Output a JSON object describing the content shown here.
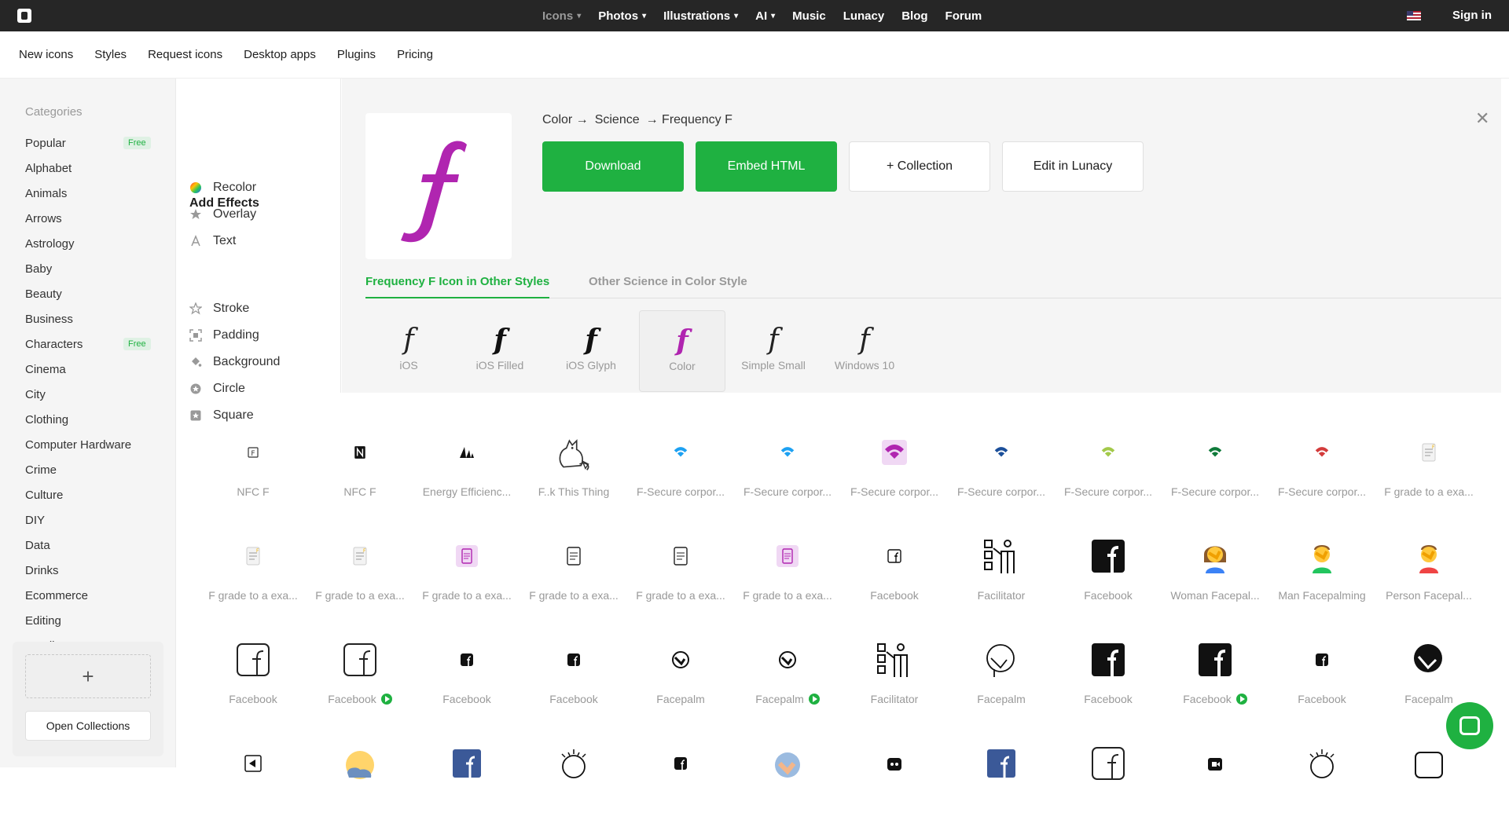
{
  "topnav": {
    "items": [
      {
        "label": "Icons",
        "dropdown": true
      },
      {
        "label": "Photos",
        "dropdown": true
      },
      {
        "label": "Illustrations",
        "dropdown": true
      },
      {
        "label": "AI",
        "dropdown": true
      },
      {
        "label": "Music",
        "dropdown": false
      },
      {
        "label": "Lunacy",
        "dropdown": false
      },
      {
        "label": "Blog",
        "dropdown": false
      },
      {
        "label": "Forum",
        "dropdown": false
      }
    ],
    "signin": "Sign in"
  },
  "subnav": [
    "New icons",
    "Styles",
    "Request icons",
    "Desktop apps",
    "Plugins",
    "Pricing"
  ],
  "sidebar": {
    "title": "Categories",
    "items": [
      {
        "label": "Popular",
        "badge": "Free"
      },
      {
        "label": "Alphabet"
      },
      {
        "label": "Animals"
      },
      {
        "label": "Arrows"
      },
      {
        "label": "Astrology"
      },
      {
        "label": "Baby"
      },
      {
        "label": "Beauty"
      },
      {
        "label": "Business"
      },
      {
        "label": "Characters",
        "badge": "Free"
      },
      {
        "label": "Cinema"
      },
      {
        "label": "City"
      },
      {
        "label": "Clothing"
      },
      {
        "label": "Computer Hardware"
      },
      {
        "label": "Crime"
      },
      {
        "label": "Culture"
      },
      {
        "label": "DIY"
      },
      {
        "label": "Data"
      },
      {
        "label": "Drinks"
      },
      {
        "label": "Ecommerce"
      },
      {
        "label": "Editing"
      },
      {
        "label": "Email"
      }
    ],
    "collections": {
      "add": "+",
      "open": "Open Collections"
    }
  },
  "effects": {
    "top": [
      {
        "label": "Recolor",
        "icon": "recolor-icon"
      },
      {
        "label": "Overlay",
        "icon": "overlay-icon"
      },
      {
        "label": "Text",
        "icon": "text-icon"
      }
    ],
    "add_title": "Add Effects",
    "add": [
      {
        "label": "Stroke",
        "icon": "star-icon"
      },
      {
        "label": "Padding",
        "icon": "padding-icon"
      },
      {
        "label": "Background",
        "icon": "fill-icon"
      },
      {
        "label": "Circle",
        "icon": "circle-icon"
      },
      {
        "label": "Square",
        "icon": "square-icon"
      }
    ]
  },
  "detail": {
    "preview_glyph": "f",
    "preview_color": "#b025b0",
    "breadcrumb": [
      "Color →",
      "Science",
      "→ Frequency F"
    ],
    "buttons": {
      "download": "Download",
      "embed": "Embed HTML",
      "collection": "+ Collection",
      "lunacy": "Edit in Lunacy"
    },
    "tabs": [
      "Frequency F Icon in Other Styles",
      "Other Science in Color Style"
    ],
    "styles": [
      {
        "label": "iOS",
        "glyph": "f"
      },
      {
        "label": "iOS Filled",
        "glyph": "f"
      },
      {
        "label": "iOS Glyph",
        "glyph": "f"
      },
      {
        "label": "Color",
        "glyph": "f"
      },
      {
        "label": "Simple Small",
        "glyph": "f"
      },
      {
        "label": "Windows 10",
        "glyph": "f"
      }
    ]
  },
  "grid": {
    "rows": [
      [
        {
          "name": "NFC F",
          "icon": "nfc-icon"
        },
        {
          "name": "NFC F",
          "icon": "nfc-filled-icon"
        },
        {
          "name": "Energy Efficienc...",
          "icon": "energy-icon"
        },
        {
          "name": "F..k This Thing",
          "icon": "cat-icon"
        },
        {
          "name": "F-Secure corpor...",
          "icon": "wifi-blue-icon"
        },
        {
          "name": "F-Secure corpor...",
          "icon": "wifi-blue-icon"
        },
        {
          "name": "F-Secure corpor...",
          "icon": "wifi-purple-icon"
        },
        {
          "name": "F-Secure corpor...",
          "icon": "wifi-dark-icon"
        },
        {
          "name": "F-Secure corpor...",
          "icon": "wifi-green-icon"
        },
        {
          "name": "F-Secure corpor...",
          "icon": "wifi-black-icon"
        },
        {
          "name": "F-Secure corpor...",
          "icon": "wifi-red-icon"
        },
        {
          "name": "F grade to a exa...",
          "icon": "document-icon"
        }
      ],
      [
        {
          "name": "F grade to a exa...",
          "icon": "document-icon"
        },
        {
          "name": "F grade to a exa...",
          "icon": "document-icon"
        },
        {
          "name": "F grade to a exa...",
          "icon": "document-purple-icon"
        },
        {
          "name": "F grade to a exa...",
          "icon": "document-outline-icon"
        },
        {
          "name": "F grade to a exa...",
          "icon": "document-outline-icon"
        },
        {
          "name": "F grade to a exa...",
          "icon": "document-purple-icon"
        },
        {
          "name": "Facebook",
          "icon": "facebook-icon"
        },
        {
          "name": "Facilitator",
          "icon": "facilitator-icon"
        },
        {
          "name": "Facebook",
          "icon": "facebook-filled-icon"
        },
        {
          "name": "Woman Facepal...",
          "icon": "woman-facepalm-icon"
        },
        {
          "name": "Man Facepalming",
          "icon": "man-facepalm-icon"
        },
        {
          "name": "Person Facepal...",
          "icon": "person-facepalm-icon"
        }
      ],
      [
        {
          "name": "Facebook",
          "icon": "facebook-outline-icon",
          "play": false
        },
        {
          "name": "Facebook",
          "icon": "facebook-outline-icon",
          "play": true
        },
        {
          "name": "Facebook",
          "icon": "facebook-small-icon",
          "play": false
        },
        {
          "name": "Facebook",
          "icon": "facebook-small-icon",
          "play": false
        },
        {
          "name": "Facepalm",
          "icon": "facepalm-icon",
          "play": false
        },
        {
          "name": "Facepalm",
          "icon": "facepalm-icon",
          "play": true
        },
        {
          "name": "Facilitator",
          "icon": "facilitator-icon",
          "play": false
        },
        {
          "name": "Facepalm",
          "icon": "facepalm-outline-icon",
          "play": false
        },
        {
          "name": "Facebook",
          "icon": "facebook-filled-icon",
          "play": false
        },
        {
          "name": "Facebook",
          "icon": "facebook-filled-icon",
          "play": true
        },
        {
          "name": "Facebook",
          "icon": "facebook-small-icon",
          "play": false
        },
        {
          "name": "Facepalm",
          "icon": "facepalm-filled-icon",
          "play": false
        }
      ],
      [
        {
          "name": "",
          "icon": "partial-icon"
        },
        {
          "name": "",
          "icon": "weather-icon"
        },
        {
          "name": "",
          "icon": "facebook-blue-icon"
        },
        {
          "name": "",
          "icon": "face-icon"
        },
        {
          "name": "",
          "icon": "facebook-small-icon"
        },
        {
          "name": "",
          "icon": "facepalm-color-icon"
        },
        {
          "name": "",
          "icon": "robot-icon"
        },
        {
          "name": "",
          "icon": "facebook-blue-icon"
        },
        {
          "name": "",
          "icon": "facebook-outline-icon"
        },
        {
          "name": "",
          "icon": "video-icon"
        },
        {
          "name": "",
          "icon": "face-icon"
        },
        {
          "name": "",
          "icon": "video-outline-icon"
        }
      ]
    ]
  }
}
